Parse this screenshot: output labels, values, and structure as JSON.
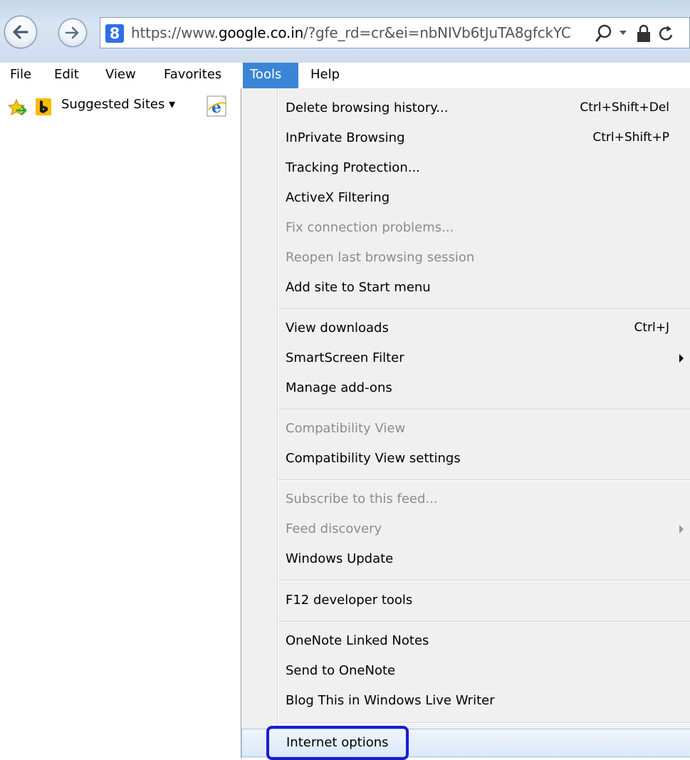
{
  "address_bar": {
    "url_prefix": "https://www.",
    "url_domain": "google.co.in",
    "url_rest": "/?gfe_rd=cr&ei=nbNIVb6tJuTA8gfckYC",
    "site_icon": "8",
    "icons": [
      "back-icon",
      "forward-icon",
      "search-icon",
      "dropdown-icon",
      "lock-icon",
      "refresh-icon"
    ]
  },
  "menubar": {
    "items": [
      "File",
      "Edit",
      "View",
      "Favorites",
      "Tools",
      "Help"
    ],
    "active": "Tools"
  },
  "favorites_bar": {
    "suggested_sites": "Suggested Sites ▾",
    "icons": [
      "favorites-star-icon",
      "bing-icon",
      "ie-icon"
    ]
  },
  "tools_menu": {
    "items": [
      {
        "label": "Delete browsing history...",
        "shortcut": "Ctrl+Shift+Del",
        "enabled": true
      },
      {
        "label": "InPrivate Browsing",
        "shortcut": "Ctrl+Shift+P",
        "enabled": true
      },
      {
        "label": "Tracking Protection...",
        "enabled": true
      },
      {
        "label": "ActiveX Filtering",
        "enabled": true
      },
      {
        "label": "Fix connection problems...",
        "enabled": false
      },
      {
        "label": "Reopen last browsing session",
        "enabled": false
      },
      {
        "label": "Add site to Start menu",
        "enabled": true
      },
      {
        "label": "View downloads",
        "shortcut": "Ctrl+J",
        "enabled": true
      },
      {
        "label": "SmartScreen Filter",
        "submenu": true,
        "enabled": true
      },
      {
        "label": "Manage add-ons",
        "enabled": true
      },
      {
        "label": "Compatibility View",
        "enabled": false
      },
      {
        "label": "Compatibility View settings",
        "enabled": true
      },
      {
        "label": "Subscribe to this feed...",
        "enabled": false
      },
      {
        "label": "Feed discovery",
        "submenu": true,
        "enabled": false
      },
      {
        "label": "Windows Update",
        "enabled": true
      },
      {
        "label": "F12 developer tools",
        "enabled": true
      },
      {
        "label": "OneNote Linked Notes",
        "enabled": true
      },
      {
        "label": "Send to OneNote",
        "enabled": true
      },
      {
        "label": "Blog This in Windows Live Writer",
        "enabled": true
      },
      {
        "label": "Internet options",
        "enabled": true,
        "highlighted": true
      }
    ]
  },
  "colors": {
    "menu_active": "#3a85d6",
    "annotation_box": "#1a1ad4",
    "menu_background": "#f0f0f0",
    "disabled_text": "#8c8c8c"
  }
}
